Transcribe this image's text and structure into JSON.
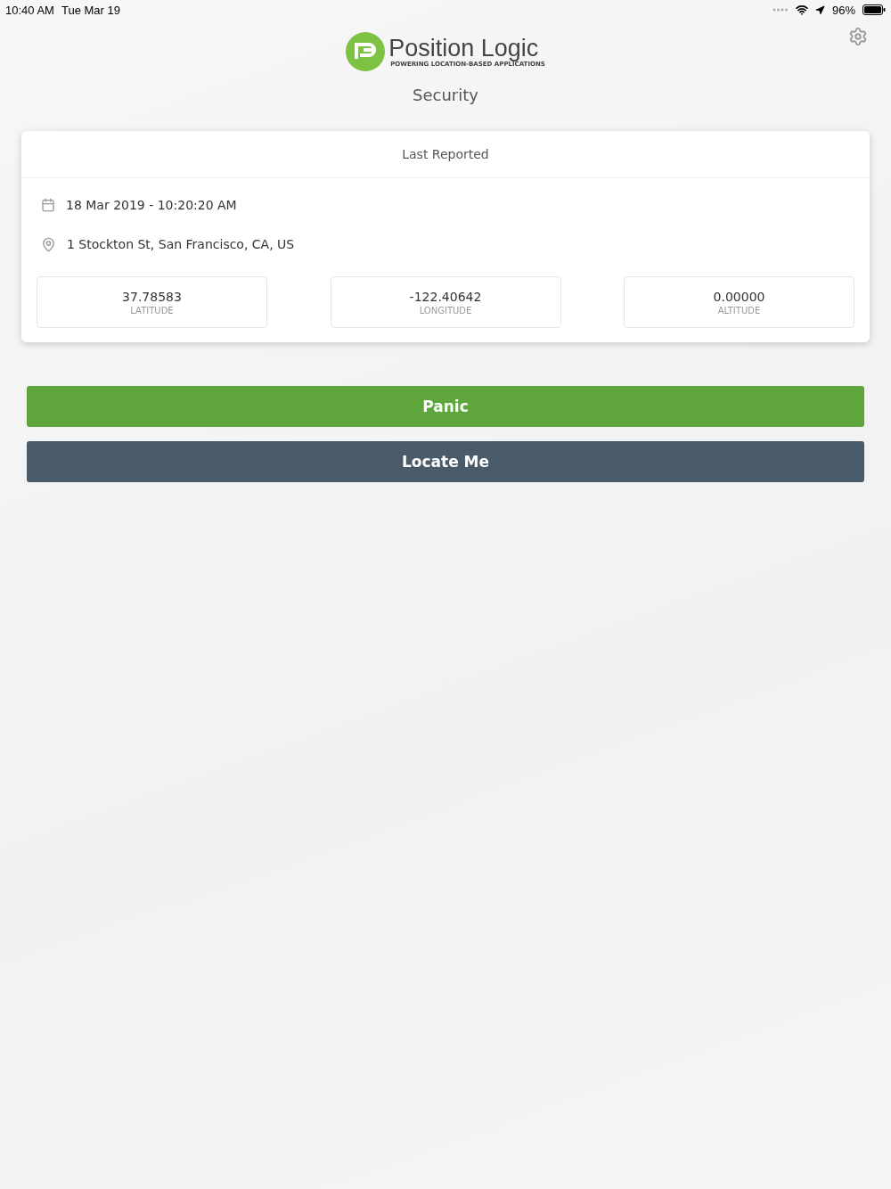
{
  "status_bar": {
    "time": "10:40 AM",
    "date": "Tue Mar 19",
    "battery": "96%"
  },
  "header": {
    "logo_text": "Position Logic",
    "logo_tagline": "POWERING LOCATION-BASED APPLICATIONS",
    "title": "Security"
  },
  "card": {
    "title": "Last Reported",
    "datetime": "18 Mar 2019 - 10:20:20 AM",
    "address": "1 Stockton St, San Francisco, CA, US",
    "stats": [
      {
        "value": "37.78583",
        "label": "LATITUDE"
      },
      {
        "value": "-122.40642",
        "label": "LONGITUDE"
      },
      {
        "value": "0.00000",
        "label": "ALTITUDE"
      }
    ]
  },
  "buttons": [
    {
      "label": "Panic",
      "kind": "primary"
    },
    {
      "label": "Locate Me",
      "kind": "secondary"
    }
  ]
}
